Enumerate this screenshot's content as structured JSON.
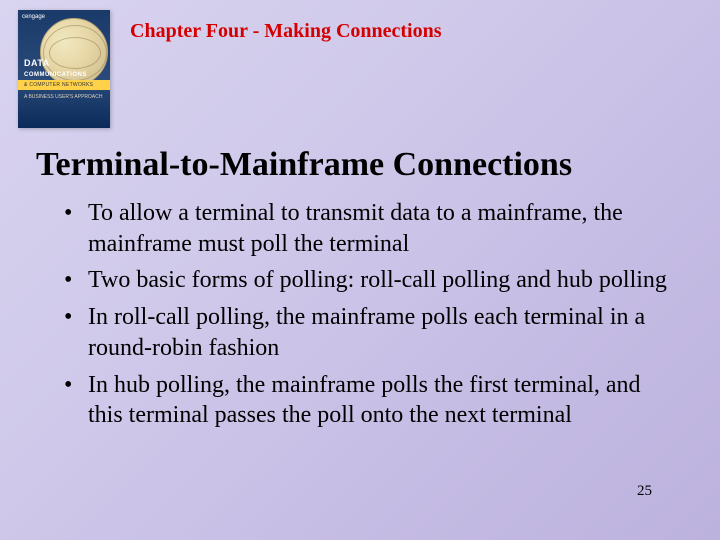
{
  "book_cover": {
    "top_label": "cengage",
    "title_line1": "DATA",
    "title_line2": "COMMUNICATIONS",
    "bar_text": "& COMPUTER NETWORKS",
    "subtitle": "A BUSINESS USER'S APPROACH"
  },
  "chapter_title": "Chapter Four - Making Connections",
  "main_title": "Terminal-to-Mainframe Connections",
  "bullets": [
    "To allow a terminal to transmit data to a mainframe, the mainframe must poll the terminal",
    "Two basic forms of polling: roll-call polling and hub polling",
    "In roll-call polling, the mainframe polls each terminal in a round-robin fashion",
    "In hub polling, the mainframe polls the first terminal, and this terminal passes the poll onto the next terminal"
  ],
  "page_number": "25"
}
